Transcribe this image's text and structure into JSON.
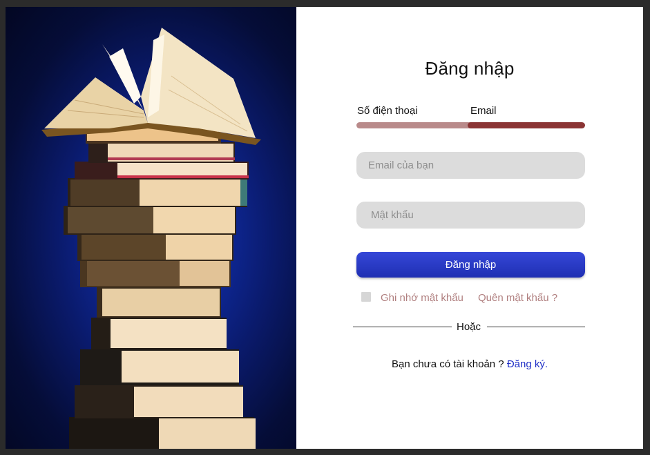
{
  "login": {
    "title": "Đăng nhập",
    "tabs": [
      {
        "label": "Số điện thoại",
        "active": false
      },
      {
        "label": "Email",
        "active": true
      }
    ],
    "email_placeholder": "Email của bạn",
    "password_placeholder": "Mật khẩu",
    "submit_label": "Đăng nhập",
    "remember_label": "Ghi nhớ mật khẩu",
    "remember_checked": false,
    "forgot_label": "Quên mật khẩu ?",
    "divider_text": "Hoặc",
    "no_account_text": "Bạn chưa có tài khoản ? ",
    "signup_label": "Đăng ký."
  },
  "colors": {
    "accent_button": "#2a3bcf",
    "active_tab_bar": "#8b3434",
    "inactive_tab_bar": "#b98a8a",
    "link_blue": "#1f2fc6",
    "muted_link": "#b07f7f",
    "field_bg": "#dcdcdc"
  }
}
